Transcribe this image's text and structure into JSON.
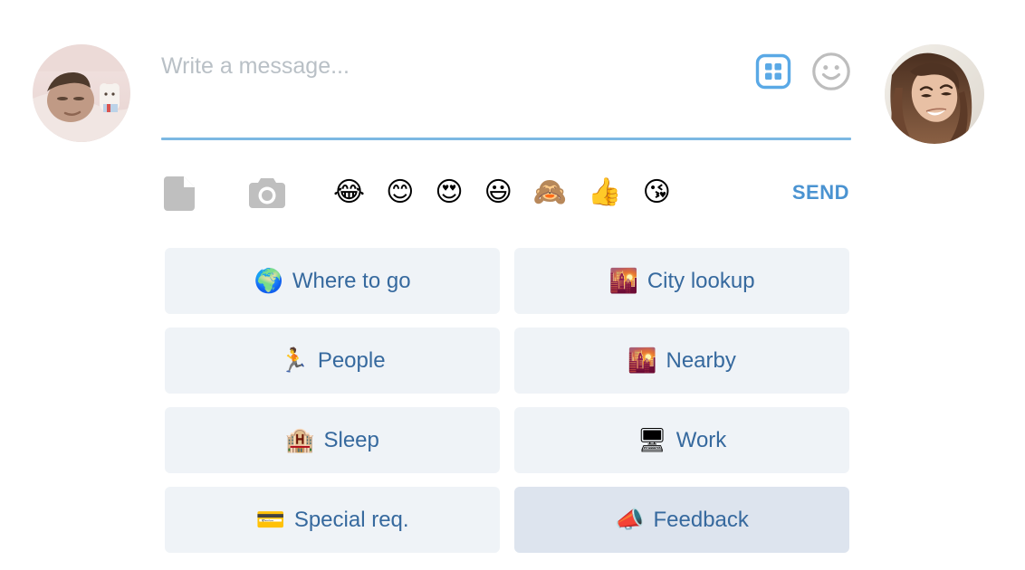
{
  "participants": {
    "left_avatar": {
      "name": "left-user-avatar",
      "alt": "person lying in bed"
    },
    "right_avatar": {
      "name": "right-user-avatar",
      "alt": "smiling woman with long brown hair"
    }
  },
  "composer": {
    "placeholder": "Write a message...",
    "value": "",
    "actions": [
      {
        "icon": "grid-icon",
        "state": "active",
        "color": "#5aa9e6"
      },
      {
        "icon": "smiley-icon",
        "state": "inactive",
        "color": "#bdbdbd"
      }
    ],
    "underline_color": "#7cb8e3"
  },
  "toolbar": {
    "file_icon": "file-icon",
    "camera_icon": "camera-icon",
    "icon_color": "#bfbfbf",
    "emojis": [
      {
        "char": "😂",
        "name": "face-with-tears-of-joy"
      },
      {
        "char": "😊",
        "name": "smiling-face-with-smiling-eyes"
      },
      {
        "char": "😍",
        "name": "smiling-face-with-heart-eyes"
      },
      {
        "char": "😃",
        "name": "grinning-face-with-big-eyes"
      },
      {
        "char": "🙈",
        "name": "see-no-evil-monkey"
      },
      {
        "char": "👍",
        "name": "thumbs-up"
      },
      {
        "char": "😘",
        "name": "face-blowing-a-kiss"
      }
    ],
    "send_label": "SEND",
    "send_color": "#4a93d1"
  },
  "quick_replies": {
    "background": "#eff3f7",
    "background_active": "#dde4ee",
    "text_color": "#36699e",
    "items": [
      {
        "emoji": "🌍",
        "emoji_name": "globe-showing-europe-africa",
        "label": "Where to go",
        "active": false
      },
      {
        "emoji": "🌇",
        "emoji_name": "sunset-over-buildings",
        "label": "City lookup",
        "active": false
      },
      {
        "emoji": "🏃",
        "emoji_name": "person-running",
        "label": "People",
        "active": false
      },
      {
        "emoji": "🌇",
        "emoji_name": "sunset-over-buildings",
        "label": "Nearby",
        "active": false
      },
      {
        "emoji": "🏨",
        "emoji_name": "hotel",
        "label": "Sleep",
        "active": false
      },
      {
        "emoji": "🖥",
        "emoji_name": "desktop-computer",
        "label": "Work",
        "active": false
      },
      {
        "emoji": "💳",
        "emoji_name": "credit-card",
        "label": "Special req.",
        "active": false
      },
      {
        "emoji": "📣",
        "emoji_name": "megaphone",
        "label": "Feedback",
        "active": true
      }
    ]
  }
}
